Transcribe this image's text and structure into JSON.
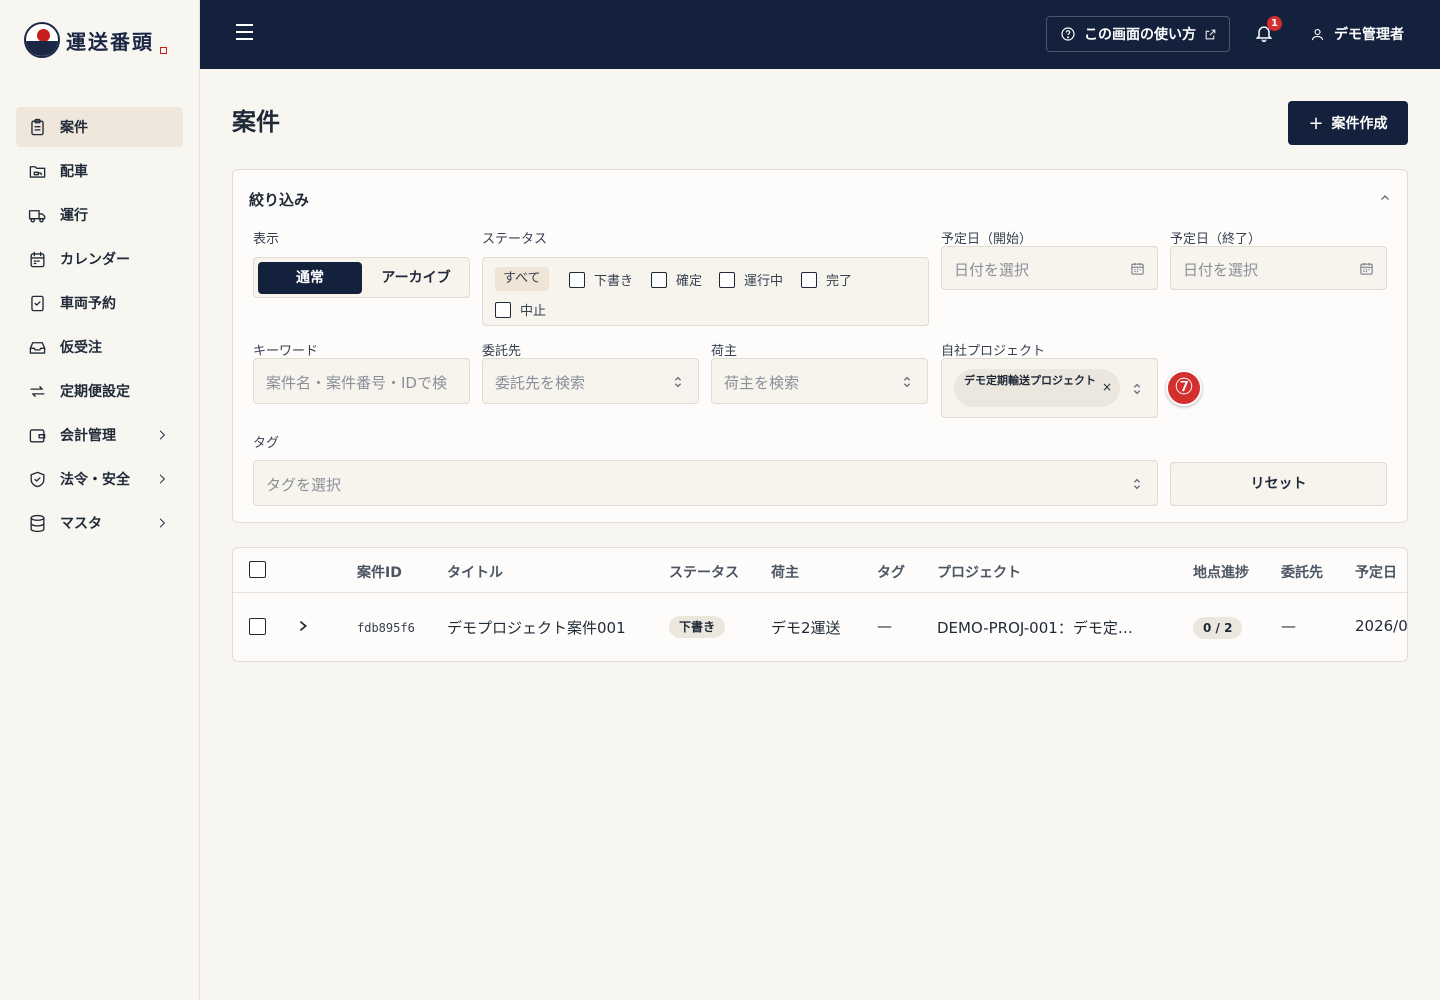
{
  "brand": {
    "name": "運送番頭"
  },
  "sidebar": {
    "items": [
      {
        "label": "案件",
        "icon": "clipboard-icon",
        "active": true
      },
      {
        "label": "配車",
        "icon": "folder-truck-icon"
      },
      {
        "label": "運行",
        "icon": "truck-icon"
      },
      {
        "label": "カレンダー",
        "icon": "calendar-icon"
      },
      {
        "label": "車両予約",
        "icon": "clipboard-check-icon"
      },
      {
        "label": "仮受注",
        "icon": "inbox-icon"
      },
      {
        "label": "定期便設定",
        "icon": "repeat-icon"
      },
      {
        "label": "会計管理",
        "icon": "wallet-icon",
        "expandable": true
      },
      {
        "label": "法令・安全",
        "icon": "shield-icon",
        "expandable": true
      },
      {
        "label": "マスタ",
        "icon": "database-icon",
        "expandable": true
      }
    ]
  },
  "header": {
    "help_label": "この画面の使い方",
    "notification_count": "1",
    "user_name": "デモ管理者"
  },
  "page": {
    "title": "案件",
    "create_button": "案件作成"
  },
  "filters": {
    "title": "絞り込み",
    "display": {
      "label": "表示",
      "options": [
        "通常",
        "アーカイブ"
      ],
      "selected": "通常"
    },
    "status": {
      "label": "ステータス",
      "all": "すべて",
      "options": [
        "下書き",
        "確定",
        "運行中",
        "完了",
        "中止"
      ]
    },
    "date_start": {
      "label": "予定日（開始）",
      "placeholder": "日付を選択"
    },
    "date_end": {
      "label": "予定日（終了）",
      "placeholder": "日付を選択"
    },
    "keyword": {
      "label": "キーワード",
      "placeholder": "案件名・案件番号・IDで検"
    },
    "contractor": {
      "label": "委託先",
      "placeholder": "委託先を検索"
    },
    "shipper": {
      "label": "荷主",
      "placeholder": "荷主を検索"
    },
    "project": {
      "label": "自社プロジェクト",
      "selected": "デモ定期輸送プロジェクト"
    },
    "tag": {
      "label": "タグ",
      "placeholder": "タグを選択"
    },
    "reset_button": "リセット",
    "step_marker": "⑦"
  },
  "table": {
    "headers": [
      "案件ID",
      "タイトル",
      "ステータス",
      "荷主",
      "タグ",
      "プロジェクト",
      "地点進捗",
      "委託先",
      "予定日"
    ],
    "rows": [
      {
        "id": "fdb895f6",
        "title": "デモプロジェクト案件001",
        "status": "下書き",
        "shipper": "デモ2運送",
        "tag": "—",
        "project": "DEMO-PROJ-001：デモ定…",
        "progress": "0 / 2",
        "contractor": "—",
        "date": "2026/0"
      }
    ]
  }
}
